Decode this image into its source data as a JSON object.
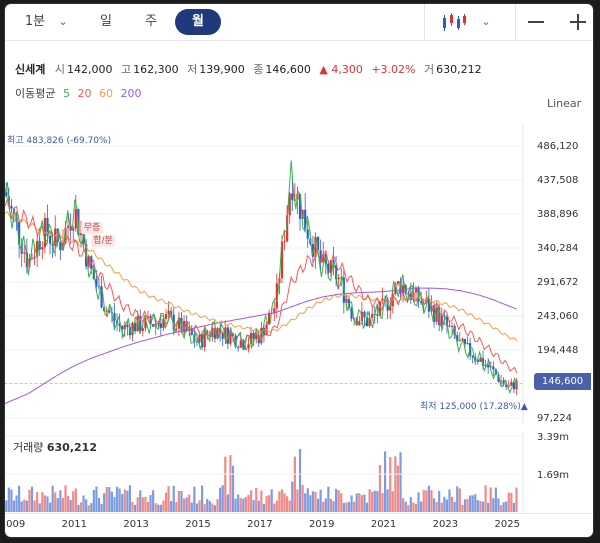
{
  "tabs": {
    "min": "1분",
    "day": "일",
    "week": "주",
    "month": "월"
  },
  "stock": {
    "name": "신세계",
    "open_label": "시",
    "open": "142,000",
    "high_label": "고",
    "high": "162,300",
    "low_label": "저",
    "low": "139,900",
    "close_label": "종",
    "close": "146,600",
    "change": "▲ 4,300",
    "change_pct": "+3.02%",
    "vol_label": "거",
    "volume": "630,212"
  },
  "ma": {
    "label": "이동평균",
    "p5": "5",
    "p20": "20",
    "p60": "60",
    "p200": "200"
  },
  "scale_label": "Linear",
  "annotations": {
    "high": "최고 483,826 (-69.70%)",
    "low": "최저 125,000 (17.28%)▲",
    "event_line1": "무증",
    "event_line2": "합/분",
    "current_price": "146,600"
  },
  "volume_panel": {
    "label": "거래량",
    "value": "630,212"
  },
  "colors": {
    "up": "#e03131",
    "down": "#2f5fc4",
    "ma5": "#37b24d",
    "ma20": "#f25c5c",
    "ma60": "#f59f4a",
    "ma200": "#a05be0",
    "accent": "#1f3a7a"
  },
  "chart_data": {
    "type": "candlestick",
    "price_axis": {
      "ticks": [
        "486,120",
        "437,508",
        "388,896",
        "340,284",
        "291,672",
        "243,060",
        "194,448",
        "146,600",
        "97,224"
      ],
      "ylim": [
        97224,
        486120
      ]
    },
    "volume_axis": {
      "ticks": [
        "3.39m",
        "1.69m"
      ],
      "ylim": [
        0,
        3390000
      ]
    },
    "x_ticks": [
      "2009",
      "2011",
      "2013",
      "2015",
      "2017",
      "2019",
      "2021",
      "2023",
      "2025"
    ],
    "x_range": [
      2008.75,
      2025.5
    ],
    "year_points": [
      2008.75,
      2009.5,
      2010.0,
      2010.5,
      2011.0,
      2011.5,
      2012.0,
      2012.5,
      2013.0,
      2013.5,
      2014.0,
      2014.5,
      2015.0,
      2015.5,
      2016.0,
      2016.5,
      2017.0,
      2017.5,
      2018.0,
      2018.5,
      2019.0,
      2019.5,
      2020.0,
      2020.5,
      2021.0,
      2021.5,
      2022.0,
      2022.5,
      2023.0,
      2023.5,
      2024.0,
      2024.5,
      2025.0,
      2025.3
    ],
    "close_points": [
      420000,
      320000,
      365000,
      345000,
      395000,
      310000,
      255000,
      225000,
      230000,
      232000,
      240000,
      225000,
      205000,
      225000,
      215000,
      205000,
      215000,
      260000,
      440000,
      370000,
      315000,
      300000,
      245000,
      235000,
      255000,
      290000,
      270000,
      255000,
      230000,
      200000,
      185000,
      165000,
      140000,
      146600
    ],
    "ma20_points": [
      400000,
      380000,
      360000,
      350000,
      345000,
      320000,
      290000,
      260000,
      245000,
      240000,
      238000,
      232000,
      222000,
      218000,
      214000,
      210000,
      212000,
      225000,
      290000,
      320000,
      330000,
      318000,
      290000,
      265000,
      258000,
      268000,
      272000,
      262000,
      245000,
      228000,
      210000,
      192000,
      172000,
      162000
    ],
    "ma60_points": [
      390000,
      375000,
      365000,
      358000,
      350000,
      338000,
      318000,
      300000,
      282000,
      270000,
      262000,
      252000,
      244000,
      237000,
      231000,
      226000,
      222000,
      222000,
      236000,
      252000,
      265000,
      272000,
      272000,
      268000,
      265000,
      266000,
      268000,
      266000,
      260000,
      252000,
      240000,
      228000,
      214000,
      208000
    ],
    "ma200_points": [
      118000,
      132000,
      146000,
      160000,
      172000,
      182000,
      190000,
      198000,
      205000,
      211000,
      217000,
      222000,
      227000,
      232000,
      236000,
      240000,
      244000,
      248000,
      256000,
      264000,
      270000,
      274000,
      276000,
      277000,
      278000,
      280000,
      283000,
      283000,
      282000,
      279000,
      274000,
      267000,
      258000,
      253000
    ],
    "current": 146600,
    "all_time_high": 483826,
    "all_time_low": 125000
  }
}
